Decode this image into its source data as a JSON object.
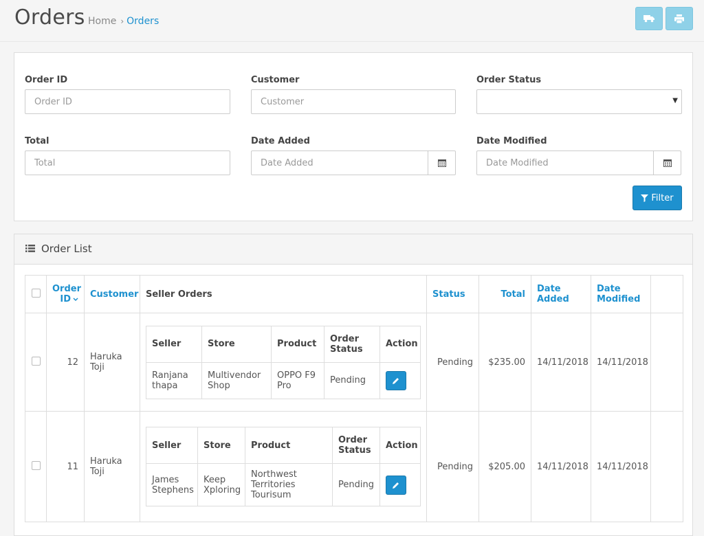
{
  "header": {
    "title": "Orders",
    "breadcrumb": [
      {
        "label": "Home"
      },
      {
        "label": "Orders"
      }
    ],
    "buttons": [
      {
        "icon": "truck-icon"
      },
      {
        "icon": "print-icon"
      }
    ]
  },
  "filter": {
    "order_id": {
      "label": "Order ID",
      "placeholder": "Order ID"
    },
    "customer": {
      "label": "Customer",
      "placeholder": "Customer"
    },
    "order_status": {
      "label": "Order Status",
      "value": ""
    },
    "total": {
      "label": "Total",
      "placeholder": "Total"
    },
    "date_added": {
      "label": "Date Added",
      "placeholder": "Date Added"
    },
    "date_modified": {
      "label": "Date Modified",
      "placeholder": "Date Modified"
    },
    "button_label": "Filter"
  },
  "order_list": {
    "heading": "Order List",
    "columns": {
      "order_id": "Order ID",
      "customer": "Customer",
      "seller_orders": "Seller Orders",
      "status": "Status",
      "total": "Total",
      "date_added": "Date Added",
      "date_modified": "Date Modified"
    },
    "inner_columns": {
      "seller": "Seller",
      "store": "Store",
      "product": "Product",
      "order_status": "Order Status",
      "action": "Action"
    },
    "rows": [
      {
        "order_id": "12",
        "customer": "Haruka Toji",
        "seller": "Ranjana thapa",
        "store": "Multivendor Shop",
        "product": "OPPO F9 Pro",
        "seller_status": "Pending",
        "status": "Pending",
        "total": "$235.00",
        "date_added": "14/11/2018",
        "date_modified": "14/11/2018"
      },
      {
        "order_id": "11",
        "customer": "Haruka Toji",
        "seller": "James Stephens",
        "store": "Keep Xploring",
        "product": "Northwest Territories Tourisum",
        "seller_status": "Pending",
        "status": "Pending",
        "total": "$205.00",
        "date_added": "14/11/2018",
        "date_modified": "14/11/2018"
      }
    ]
  },
  "colors": {
    "primary": "#1e91cf",
    "header_button": "#8fd1e8"
  }
}
